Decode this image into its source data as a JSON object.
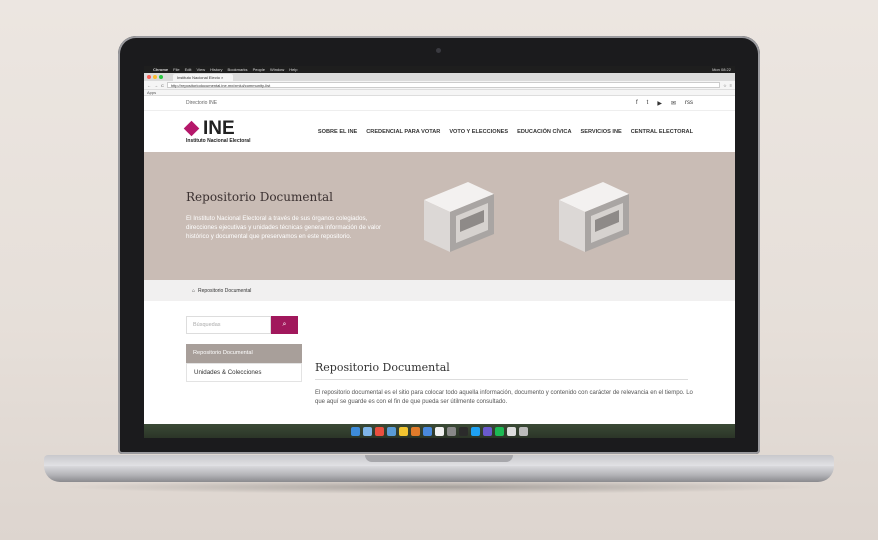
{
  "menubar": {
    "app": "Chrome",
    "items": [
      "File",
      "Edit",
      "View",
      "History",
      "Bookmarks",
      "People",
      "Window",
      "Help"
    ],
    "clock": "Mon 08:22"
  },
  "browser": {
    "tab_title": "Instituto Nacional Electo ×",
    "url": "http://repositoriodocumental.ine.mx/xmlui/community-list",
    "bookmarks_label": "Apps"
  },
  "topbar": {
    "directory_label": "Directorio INE",
    "social_icons": [
      "f",
      "t",
      "▶",
      "✉",
      "rss"
    ]
  },
  "header": {
    "logo_text": "INE",
    "logo_subtitle": "Instituto Nacional Electoral",
    "nav": [
      "SOBRE EL INE",
      "CREDENCIAL PARA VOTAR",
      "VOTO Y ELECCIONES",
      "EDUCACIÓN CÍVICA",
      "SERVICIOS INE",
      "CENTRAL ELECTORAL"
    ]
  },
  "hero": {
    "title": "Repositorio Documental",
    "description": "El Instituto Nacional Electoral a través de sus órganos colegiados, direcciones ejecutivas y unidades técnicas genera información de valor histórico y documental que preservamos en este repositorio."
  },
  "breadcrumb": {
    "label": "Repositorio Documental"
  },
  "sidebar": {
    "search_placeholder": "Búsquedas",
    "items": [
      "Repositorio Documental",
      "Unidades & Colecciones"
    ]
  },
  "main": {
    "title": "Repositorio Documental",
    "text": "El repositorio documental es el sitio para colocar todo aquella información, documento y contenido con carácter de relevancia en el tiempo. Lo que aquí se guarde es con el fin de que pueda ser útilmente consultado."
  },
  "colors": {
    "brand": "#b5176a",
    "hero_bg": "#c9bcb5",
    "search_button": "#a1185c"
  }
}
